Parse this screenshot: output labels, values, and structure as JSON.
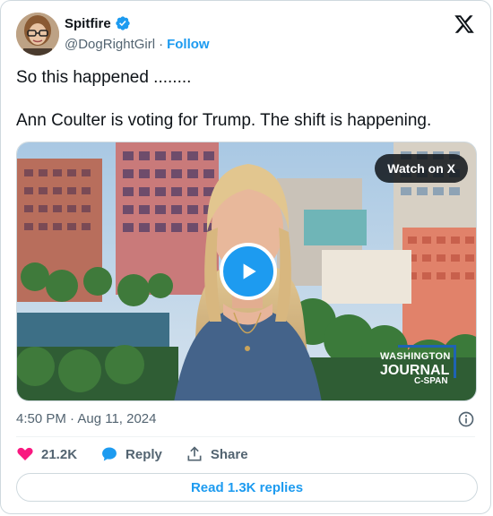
{
  "author": {
    "display_name": "Spitfire",
    "handle": "@DogRightGirl",
    "separator": "·",
    "follow_label": "Follow"
  },
  "tweet": {
    "text": "So this happened ........\n\nAnn Coulter is voting for Trump. The shift is happening."
  },
  "media": {
    "watch_label": "Watch on X",
    "logo_line1": "WASHINGTON",
    "logo_line2": "JOURNAL",
    "logo_line3": "C-SPAN"
  },
  "meta": {
    "timestamp": "4:50 PM · Aug 11, 2024"
  },
  "actions": {
    "likes": "21.2K",
    "reply_label": "Reply",
    "share_label": "Share",
    "read_replies_label": "Read 1.3K replies"
  },
  "colors": {
    "accent": "#1d9bf0",
    "like": "#f91880",
    "muted": "#536471",
    "border": "#cfd9de"
  }
}
